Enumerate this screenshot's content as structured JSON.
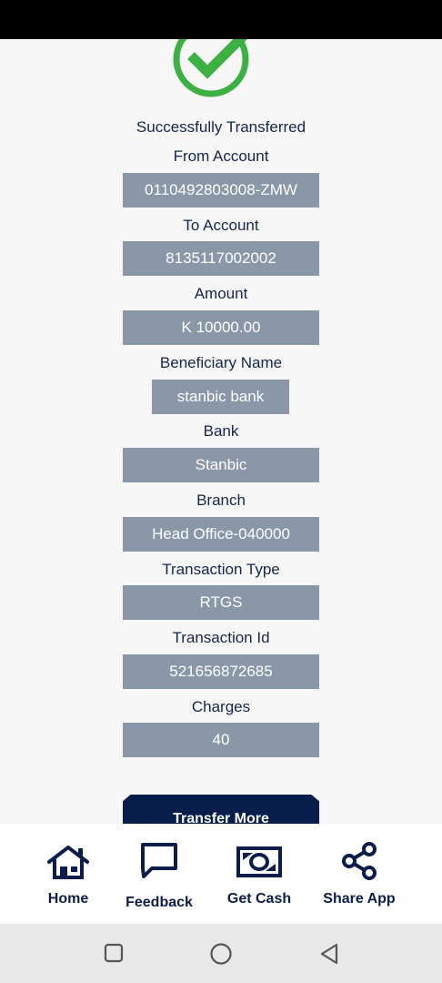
{
  "status": "Successfully Transferred",
  "fields": [
    {
      "label": "From Account",
      "value": "0110492803008-ZMW"
    },
    {
      "label": "To Account",
      "value": "8135117002002"
    },
    {
      "label": "Amount",
      "value": "K 10000.00"
    },
    {
      "label": "Beneficiary Name",
      "value": "stanbic bank"
    },
    {
      "label": "Bank",
      "value": "Stanbic"
    },
    {
      "label": "Branch",
      "value": "Head Office-040000"
    },
    {
      "label": "Transaction Type",
      "value": "RTGS"
    },
    {
      "label": "Transaction Id",
      "value": "521656872685"
    },
    {
      "label": "Charges",
      "value": "40"
    }
  ],
  "transfer_more_label": "Transfer More",
  "nav": [
    {
      "label": "Home",
      "icon": "home-icon"
    },
    {
      "label": "Feedback",
      "icon": "feedback-icon"
    },
    {
      "label": "Get Cash",
      "icon": "cash-icon"
    },
    {
      "label": "Share App",
      "icon": "share-icon"
    }
  ],
  "colors": {
    "accent": "#071d4c",
    "success": "#3cb043",
    "field_bg": "#8a97a8"
  }
}
